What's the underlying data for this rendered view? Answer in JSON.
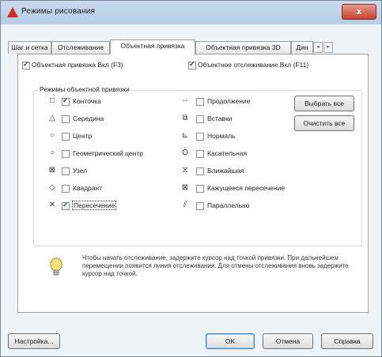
{
  "window": {
    "title": "Режимы рисования",
    "close": "x"
  },
  "tabs": {
    "items": [
      "Шаг и сетка",
      "Отслеживание",
      "Объектная привязка",
      "Объектная привязка 3D",
      "Дин"
    ],
    "active_index": 2,
    "scroll_left": "◂",
    "scroll_right": "▸"
  },
  "header": {
    "snap_on_label": "Объектная привязка Вкл (F3)",
    "snap_on_checked": true,
    "tracking_on_label": "Объектное отслеживание Вкл (F11)",
    "tracking_on_checked": true
  },
  "modes": {
    "title": "Режимы объектной привязки",
    "left": [
      {
        "icon": "endpoint-square-icon",
        "glyph": "□",
        "label": "Конточка",
        "checked": true
      },
      {
        "icon": "midpoint-triangle-icon",
        "glyph": "△",
        "label": "Середина",
        "checked": false
      },
      {
        "icon": "center-circle-icon",
        "glyph": "○",
        "label": "Центр",
        "checked": false
      },
      {
        "icon": "geometric-center-icon",
        "glyph": "○",
        "label": "Геометрический центр",
        "checked": false
      },
      {
        "icon": "node-icon",
        "glyph": "⊠",
        "label": "Узел",
        "checked": false
      },
      {
        "icon": "quadrant-diamond-icon",
        "glyph": "◇",
        "label": "Квадрант",
        "checked": false
      },
      {
        "icon": "intersection-x-icon",
        "glyph": "✕",
        "label": "Пересечение",
        "checked": true
      }
    ],
    "right": [
      {
        "icon": "extension-icon",
        "glyph": "‐‐",
        "label": "Продолжение",
        "checked": false
      },
      {
        "icon": "insertion-icon",
        "glyph": "⧉",
        "label": "Вставки",
        "checked": false
      },
      {
        "icon": "perpendicular-icon",
        "glyph": "⊾",
        "label": "Нормаль",
        "checked": false
      },
      {
        "icon": "tangent-icon",
        "glyph": "Ō",
        "label": "Касательная",
        "checked": false
      },
      {
        "icon": "nearest-icon",
        "glyph": "⧖",
        "label": "Ближайшая",
        "checked": false
      },
      {
        "icon": "apparent-intersection-icon",
        "glyph": "⊠",
        "label": "Кажущееся пересечение",
        "checked": false
      },
      {
        "icon": "parallel-icon",
        "glyph": "⫽",
        "label": "Параллельно",
        "checked": false
      }
    ],
    "select_all": "Выбрать все",
    "clear_all": "Очистить все"
  },
  "hint": "Чтобы начать отслеживание, задержите курсор над точкой привязки. При дальнейшем перемещении появится линия отслеживания. Для отмены отслеживания вновь задержите курсор над точкой.",
  "footer": {
    "settings": "Настройка...",
    "ok": "OK",
    "cancel": "Отмена",
    "help": "Справка"
  },
  "colors": {
    "title_bar": "#b9cfe8",
    "close_button": "#c8432e",
    "accent": "#1d3d8a"
  }
}
